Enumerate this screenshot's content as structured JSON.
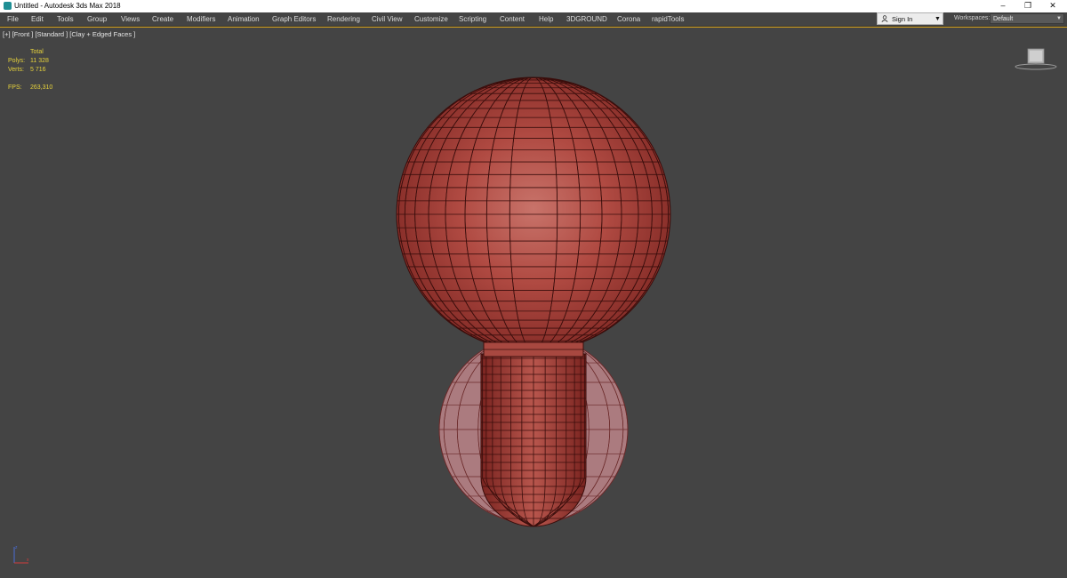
{
  "window": {
    "title": "Untitled - Autodesk 3ds Max 2018",
    "controls": {
      "minimize": "–",
      "restore": "❐",
      "close": "✕"
    }
  },
  "menu": [
    "File",
    "Edit",
    "Tools",
    "Group",
    "Views",
    "Create",
    "Modifiers",
    "Animation",
    "Graph Editors",
    "Rendering",
    "Civil View",
    "Customize",
    "Scripting",
    "Content",
    "Help",
    "3DGROUND",
    "Corona",
    "rapidTools"
  ],
  "account": {
    "signin_label": "Sign In"
  },
  "workspaces": {
    "label": "Workspaces:",
    "value": "Default"
  },
  "viewport": {
    "label": "[+] [Front ] [Standard ] [Clay + Edged Faces ]",
    "stats": {
      "header": "Total",
      "polys_label": "Polys:",
      "polys_value": "11 328",
      "verts_label": "Verts:",
      "verts_value": "5 716",
      "fps_label": "FPS:",
      "fps_value": "263,310"
    }
  },
  "colors": {
    "viewport_bg": "#444444",
    "model_red": "#a8403a",
    "stats_yellow": "#e6d23c",
    "active_border": "#d8a41c"
  },
  "icons": [
    "app-icon",
    "user-icon",
    "dropdown-arrow-icon",
    "viewcube-icon",
    "axis-tripod-icon"
  ]
}
